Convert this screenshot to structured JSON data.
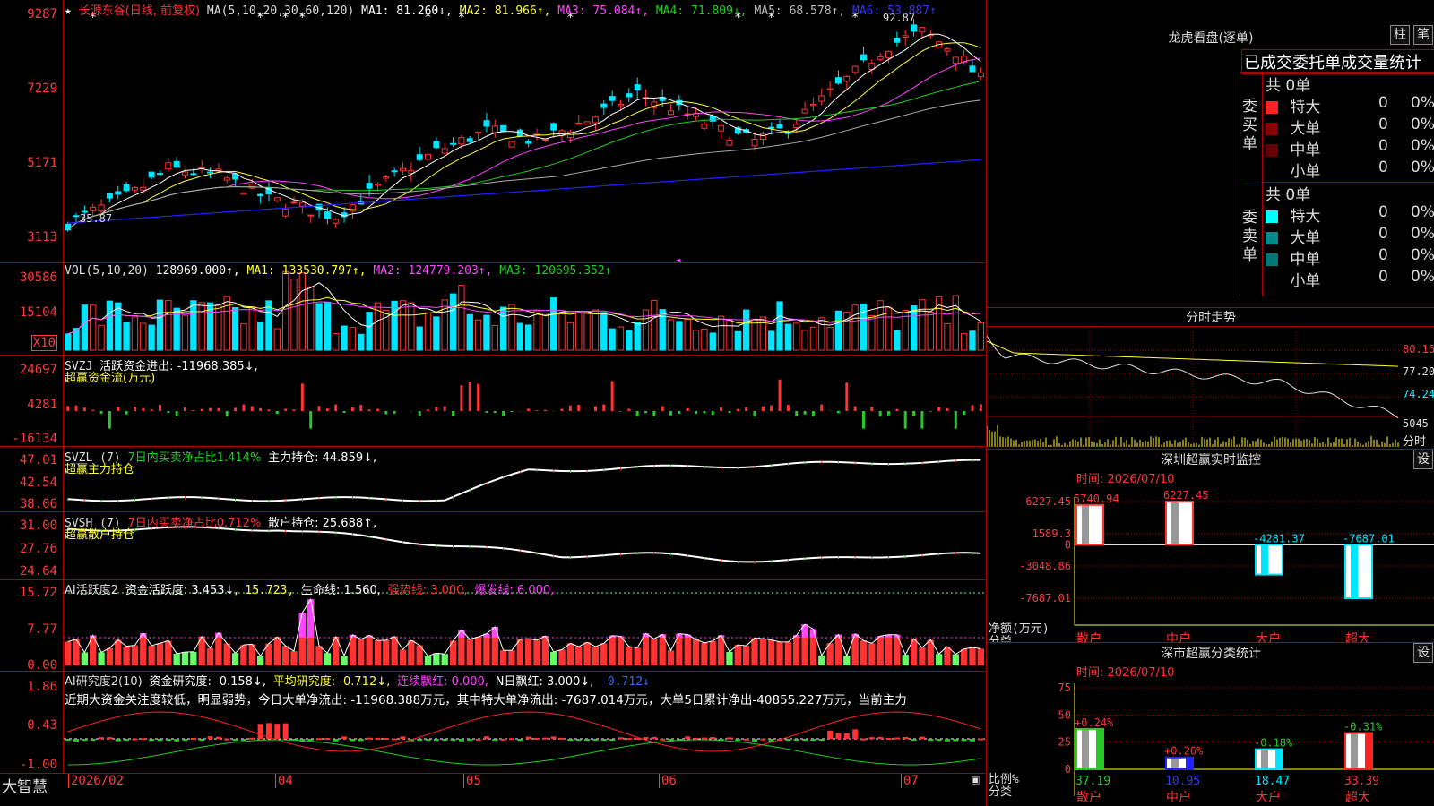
{
  "colors": {
    "up": "#ff3333",
    "down": "#00e5ff",
    "grid": "#aa0000",
    "axis": "#ff3b3b",
    "white": "#ffffff",
    "yellow": "#ffff33",
    "magenta": "#ff44ff",
    "green": "#22cc22",
    "gray": "#aaaaaa",
    "blue": "#2222ff",
    "lightgreen": "#66ff66"
  },
  "main": {
    "stock": "长源东谷",
    "period": "(日线, 前复权)",
    "ma_label": "MA(5,10,20,30,60,120)",
    "ma1": "MA1: 81.260↓,",
    "ma2": "MA2: 81.966↑,",
    "ma3": "MA3: 75.084↑,",
    "ma4": "MA4: 71.809↓,",
    "ma5": "MA5: 68.578↑,",
    "ma6": "MA6: 53.887↑",
    "y_labels": [
      "9287",
      "7229",
      "5171",
      "3113"
    ],
    "high_label": "92.87",
    "low_label": "35.87"
  },
  "vol": {
    "title": "VOL(5,10,20)",
    "v": "128969.000↑,",
    "ma1": "MA1: 133530.797↑,",
    "ma2": "MA2: 124779.203↑,",
    "ma3": "MA3: 120695.352↑",
    "y_labels": [
      "30586",
      "15104"
    ],
    "unit": "X10"
  },
  "svzj": {
    "title": "SVZJ",
    "t1": "活跃资金进出: -11968.385↓,",
    "t2": "超赢资金流(万元)",
    "y_labels": [
      "24697",
      "4281",
      "-16134"
    ]
  },
  "svzl": {
    "title": "SVZL (7)",
    "t1": "7日内买卖净占比1.414%",
    "t2": "主力持仓: 44.859↓,",
    "t3": "超赢主力持仓",
    "y_labels": [
      "47.01",
      "42.54",
      "38.06"
    ]
  },
  "svsh": {
    "title": "SVSH (7)",
    "t1": "7日内买卖净占比0.712%",
    "t2": "散户持仓: 25.688↑,",
    "t3": "超赢散户持仓",
    "y_labels": [
      "31.00",
      "27.76",
      "24.64"
    ]
  },
  "ai1": {
    "title": "AI活跃度2",
    "t1": "资金活跃度: 3.453↓,",
    "t2": "15.723,",
    "t3": "生命线: 1.560,",
    "t4": "强势线: 3.000,",
    "t5": "爆发线: 6.000,",
    "y_labels": [
      "15.72",
      "7.77",
      "0.00"
    ]
  },
  "ai2": {
    "title": "AI研究度2(10)",
    "t1": "资金研究度: -0.158↓,",
    "t2": "平均研究度: -0.712↓,",
    "t3": "连续飘红: 0.000,",
    "t4": "N日飘红: 3.000↓,",
    "t5": "-0.712↓",
    "comment": "近期大资金关注度较低，明显弱势，今日大单净流出: -11968.388万元，其中特大单净流出: -7687.014万元，大单5日累计净出-40855.227万元，当前主力",
    "y_labels": [
      "1.86",
      "0.43",
      "-1.00"
    ]
  },
  "xaxis": {
    "labels": [
      "2026/02",
      "04",
      "05",
      "06",
      "07"
    ],
    "brand": "大智慧"
  },
  "longhu": {
    "title": "龙虎看盘(逐单)",
    "btn1": "柱",
    "btn2": "笔",
    "tabs": "已成交委托单成交量统计",
    "buy_label": "委买单",
    "sell_label": "委卖单",
    "buy_total": "共 0单",
    "sell_total": "共 0单",
    "buy_rows": [
      {
        "name": "特大",
        "n": "0",
        "p": "0%",
        "c": "#ff2222"
      },
      {
        "name": "大单",
        "n": "0",
        "p": "0%",
        "c": "#880000"
      },
      {
        "name": "中单",
        "n": "0",
        "p": "0%",
        "c": "#660000"
      },
      {
        "name": "小单",
        "n": "0",
        "p": "0%",
        "c": ""
      }
    ],
    "sell_rows": [
      {
        "name": "特大",
        "n": "0",
        "p": "0%",
        "c": "#00ffff"
      },
      {
        "name": "大单",
        "n": "0",
        "p": "0%",
        "c": "#008b8b"
      },
      {
        "name": "中单",
        "n": "0",
        "p": "0%",
        "c": "#007777"
      },
      {
        "name": "小单",
        "n": "0",
        "p": "0%",
        "c": ""
      }
    ]
  },
  "fenshi": {
    "title": "分时走势",
    "labels": [
      "80.16",
      "77.20",
      "74.24",
      "5045"
    ],
    "unit": "分时"
  },
  "monitor": {
    "title": "深圳超赢实时监控",
    "btn": "设",
    "time": "时间: 2026/07/10",
    "y_labels": [
      "6227.45",
      "1589.3",
      "0",
      "-3048.86",
      "-7687.01"
    ],
    "axis_title1": "净额(万元)",
    "axis_title2": "分类",
    "categories": [
      "散户",
      "中户",
      "大户",
      "超大"
    ],
    "value_labels": [
      "5740.94",
      "6227.45",
      "-4281.37",
      "-7687.01"
    ]
  },
  "classify": {
    "title": "深市超赢分类统计",
    "btn": "设",
    "time": "时间: 2026/07/10",
    "y_labels": [
      "75",
      "50",
      "25",
      "0"
    ],
    "axis_title1": "比例%",
    "axis_title2": "分类",
    "categories": [
      "散户",
      "中户",
      "大户",
      "超大"
    ],
    "pct_labels": [
      "+0.24%",
      "+0.26%",
      "-0.18%",
      "-0.31%"
    ],
    "value_labels": [
      "37.19",
      "10.95",
      "18.47",
      "33.39"
    ]
  },
  "chart_data": [
    {
      "type": "bar",
      "title": "深圳超赢实时监控",
      "categories": [
        "散户",
        "中户",
        "大户",
        "超大"
      ],
      "values": [
        5740.94,
        6227.45,
        -4281.37,
        -7687.01
      ],
      "ylabel": "净额(万元)",
      "ylim": [
        -7687.01,
        6227.45
      ]
    },
    {
      "type": "bar",
      "title": "深市超赢分类统计",
      "categories": [
        "散户",
        "中户",
        "大户",
        "超大"
      ],
      "values": [
        37.19,
        10.95,
        18.47,
        33.39
      ],
      "changes": [
        "+0.24%",
        "+0.26%",
        "-0.18%",
        "-0.31%"
      ],
      "ylabel": "比例%",
      "ylim": [
        0,
        75
      ]
    }
  ]
}
